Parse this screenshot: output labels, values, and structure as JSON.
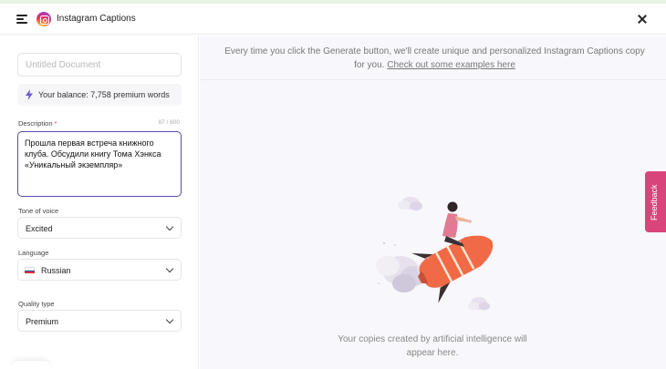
{
  "header": {
    "title": "Instagram Captions",
    "menu_icon": "hamburger-icon",
    "logo_icon": "instagram-icon",
    "close_icon": "close-icon"
  },
  "sidebar": {
    "document_placeholder": "Untitled Document",
    "balance": "Your balance: 7,758 premium words",
    "balance_icon": "lightning-icon",
    "description_label": "Description",
    "required_mark": "*",
    "char_counter": "87 / 600",
    "description_value": "Прошла первая встреча книжного клуба. Обсудили книгу Тома Хэнкса «Уникальный экземпляр»",
    "tone_label": "Tone of voice",
    "tone_value": "Excited",
    "language_label": "Language",
    "language_value": "Russian",
    "language_flag": "russia-flag-icon",
    "quality_label": "Quality type",
    "quality_value": "Premium"
  },
  "main": {
    "info_text": "Every time you click the Generate button, we'll create unique and personalized Instagram Captions copy for you.",
    "info_link": "Check out some examples here",
    "empty_text": "Your copies created by artificial intelligence will appear here.",
    "illustration": "person-riding-rocket-illustration"
  },
  "feedback_label": "Feedback",
  "colors": {
    "accent_border": "#5a4bb0",
    "feedback_tab": "#d9457a",
    "main_bg": "#f8f7fb",
    "bolt": "#6b5bd6"
  }
}
